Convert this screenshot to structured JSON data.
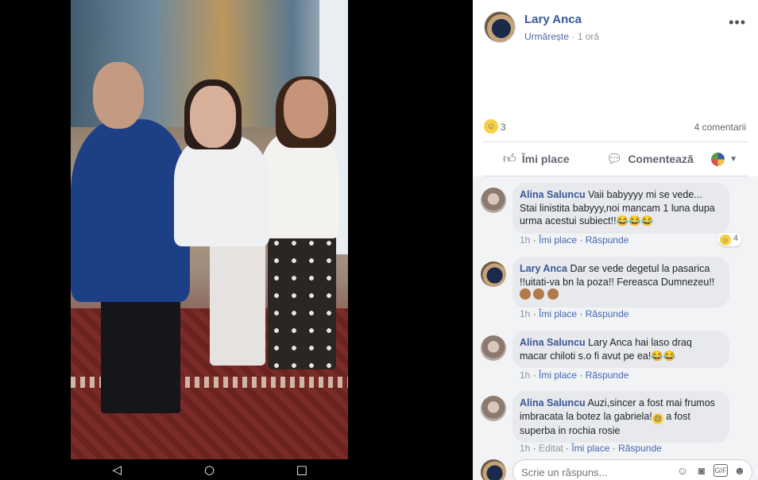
{
  "nav": {
    "back_glyph": "◁",
    "home_glyph": "○",
    "recents_glyph": "□"
  },
  "post": {
    "author": "Lary Anca",
    "follow": "Urmărește",
    "separator": "·",
    "time": "1 oră",
    "more_glyph": "•••",
    "reaction_icon": "haha-icon",
    "reaction_count": "3",
    "comment_count": "4 comentarii"
  },
  "actions": {
    "like_label": "Îmi place",
    "comment_label": "Comentează"
  },
  "comments": [
    {
      "name": "Alina Saluncu",
      "text": "Vaii babyyyy mi se vede... Stai linistita babyyy,noi mancam 1 luna dupa urma acestui subiect!!",
      "emoji": "😂😂😂",
      "time": "1h",
      "like": "Îmi place",
      "reply": "Răspunde",
      "reaction_count": "4"
    },
    {
      "name": "Lary Anca",
      "text": "Dar se vede degetul la pasarica !!uitati-va bn la poza!! Fereasca Dumnezeu!!",
      "time": "1h",
      "like": "Îmi place",
      "reply": "Răspunde"
    },
    {
      "name": "Alina Saluncu",
      "text": "Lary Anca hai laso draq macar chiloti s.o fi avut pe ea!",
      "emoji": "😂😂",
      "time": "1h",
      "like": "Îmi place",
      "reply": "Răspunde"
    },
    {
      "name": "Alina Saluncu",
      "text_a": "Auzi,sincer a fost mai frumos imbracata la botez la gabriela!",
      "text_b": " a fost superba in rochia rosie",
      "time": "1h",
      "edited": "Editat",
      "like": "Îmi place",
      "reply": "Răspunde"
    }
  ],
  "reply": {
    "placeholder": "Scrie un răspuns..."
  },
  "colors": {
    "link": "#365899",
    "accent": "#4267b2",
    "panel_bg": "#ffffff",
    "comments_bg": "#f2f3f5"
  }
}
